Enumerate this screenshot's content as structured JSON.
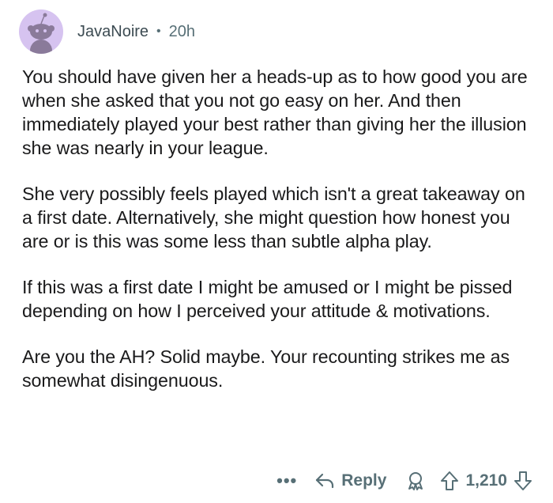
{
  "comment": {
    "author": "JavaNoire",
    "separator": "•",
    "age": "20h",
    "paragraphs": [
      "You should have given her a heads-up as to how good you are when she asked that you not go easy on her. And then immediately played your best rather than giving her the illusion she was nearly in your league.",
      "She very possibly feels played which isn't a great takeaway on a first date. Alternatively, she might question how honest you are or is this was some less than subtle alpha play.",
      "If this was a first date I might be amused or I might be pissed depending on how I perceived your attitude & motivations.",
      "Are you the AH? Solid maybe. Your recounting strikes me as somewhat disingenuous."
    ]
  },
  "actions": {
    "more": "•••",
    "reply_label": "Reply",
    "score": "1,210",
    "icons": {
      "reply": "reply-arrow-icon",
      "award": "award-icon",
      "upvote": "upvote-arrow-icon",
      "downvote": "downvote-arrow-icon",
      "avatar": "snoo-avatar-icon"
    }
  },
  "colors": {
    "avatar_bg": "#d6c3f0",
    "meta_text": "#576f76",
    "body_text": "#1a1a1b"
  }
}
